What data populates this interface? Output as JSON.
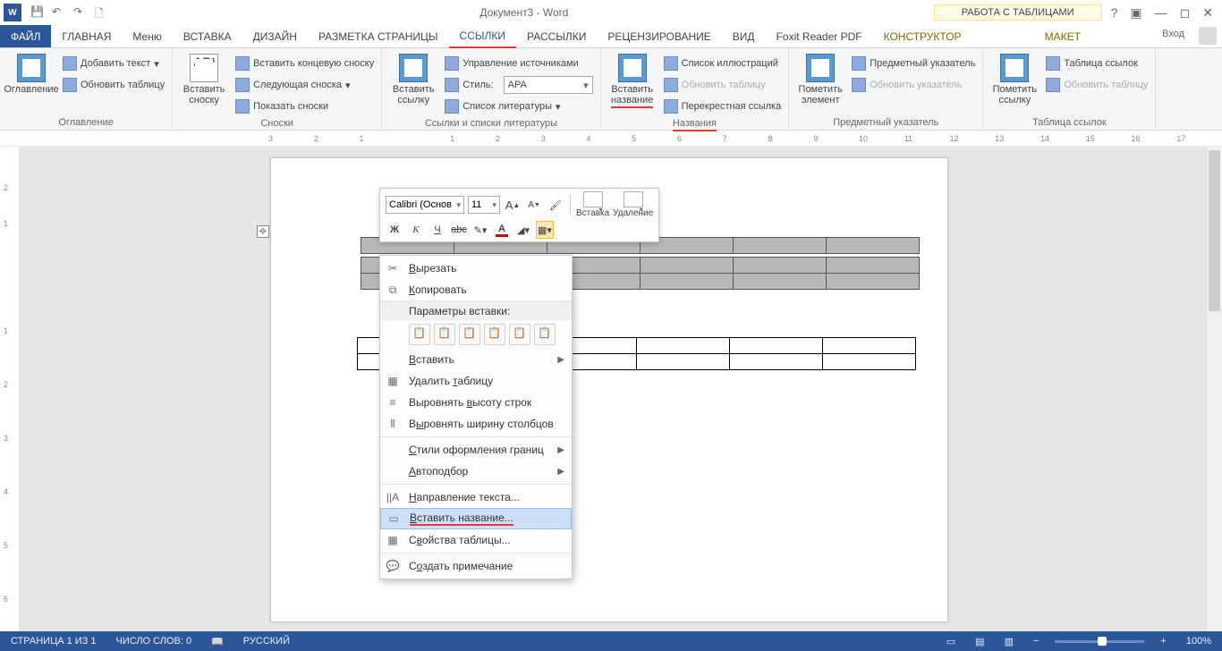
{
  "title": "Документ3 - Word",
  "tabtools_label": "РАБОТА С ТАБЛИЦАМИ",
  "signin_label": "Вход",
  "tabs": {
    "file": "ФАЙЛ",
    "home": "ГЛАВНАЯ",
    "menu": "Меню",
    "insert": "ВСТАВКА",
    "design": "ДИЗАЙН",
    "layout": "РАЗМЕТКА СТРАНИЦЫ",
    "references": "ССЫЛКИ",
    "mailings": "РАССЫЛКИ",
    "review": "РЕЦЕНЗИРОВАНИЕ",
    "view": "ВИД",
    "foxit": "Foxit Reader PDF",
    "constructor": "КОНСТРУКТОР",
    "maket": "МАКЕТ"
  },
  "ribbon": {
    "toc": {
      "big": "Оглавление",
      "add_text": "Добавить текст",
      "update": "Обновить таблицу",
      "group": "Оглавление"
    },
    "footnotes": {
      "big": "Вставить\nсноску",
      "insert_end": "Вставить концевую сноску",
      "next": "Следующая сноска",
      "show": "Показать сноски",
      "group": "Сноски"
    },
    "citations": {
      "big": "Вставить\nссылку",
      "manage": "Управление источниками",
      "style_label": "Стиль:",
      "style_value": "APA",
      "biblio": "Список литературы",
      "group": "Ссылки и списки литературы"
    },
    "captions": {
      "big": "Вставить\nназвание",
      "list_fig": "Список иллюстраций",
      "update": "Обновить таблицу",
      "cross": "Перекрестная ссылка",
      "group": "Названия"
    },
    "index": {
      "big": "Пометить\nэлемент",
      "subject": "Предметный указатель",
      "update": "Обновить указатель",
      "group": "Предметный указатель"
    },
    "toa": {
      "big": "Пометить\nссылку",
      "table": "Таблица ссылок",
      "update": "Обновить таблицу",
      "group": "Таблица ссылок"
    }
  },
  "minitoolbar": {
    "font": "Calibri (Основ",
    "size": "11",
    "insert": "Вставка",
    "delete": "Удаление"
  },
  "context": {
    "cut": "Вырезать",
    "copy": "Копировать",
    "paste_header": "Параметры вставки:",
    "insert": "Вставить",
    "delete_table": "Удалить таблицу",
    "dist_rows": "Выровнять высоту строк",
    "dist_cols": "Выровнять ширину столбцов",
    "border_styles": "Стили оформления границ",
    "autofit": "Автоподбор",
    "text_direction": "Направление текста...",
    "insert_caption": "Вставить название...",
    "table_props": "Свойства таблицы...",
    "new_comment": "Создать примечание"
  },
  "statusbar": {
    "page": "СТРАНИЦА 1 ИЗ 1",
    "words": "ЧИСЛО СЛОВ: 0",
    "lang": "РУССКИЙ",
    "zoom": "100%"
  },
  "ruler_ticks": [
    "3",
    "2",
    "1",
    "",
    "1",
    "2",
    "3",
    "4",
    "5",
    "6",
    "7",
    "8",
    "9",
    "10",
    "11",
    "12",
    "13",
    "14",
    "15",
    "16",
    "17"
  ]
}
